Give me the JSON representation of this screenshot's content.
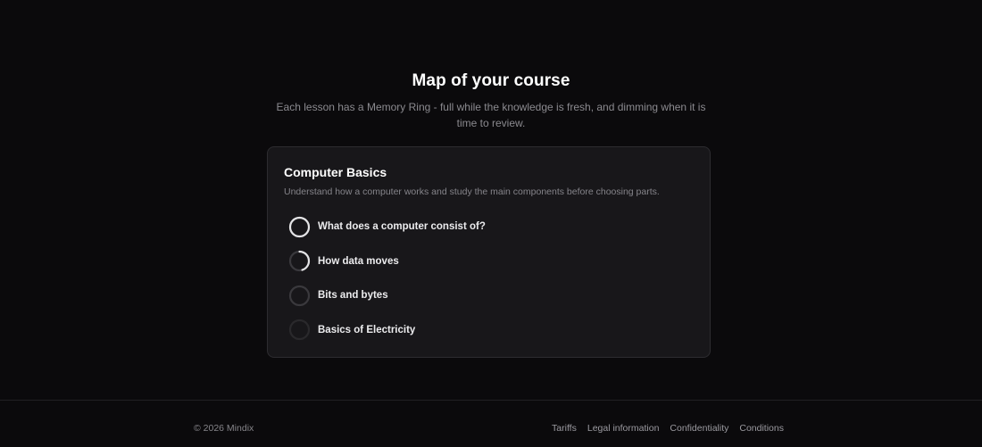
{
  "hero": {
    "title": "Map of your course",
    "subtitle": "Each lesson has a Memory Ring - full while the knowledge is fresh, and dimming when it is time to review."
  },
  "course": {
    "title": "Computer Basics",
    "description": "Understand how a computer works and study the main components before choosing parts.",
    "lessons": [
      {
        "label": "What does a computer consist of?",
        "memory_ring": 1.0,
        "ring_icon": "memory-ring-full-icon"
      },
      {
        "label": "How data moves",
        "memory_ring": 0.45,
        "ring_icon": "memory-ring-partial-icon"
      },
      {
        "label": "Bits and bytes",
        "memory_ring": 0.0,
        "ring_icon": "memory-ring-empty-icon"
      },
      {
        "label": "Basics of Electricity",
        "memory_ring": 0.0,
        "ring_icon": "memory-ring-dim-icon"
      }
    ]
  },
  "colors": {
    "background": "#0b0a0c",
    "card": "#18171a",
    "ring_fill": "#e4e4e6",
    "ring_track": "#3a393d",
    "ring_track_dim": "#2a292c"
  },
  "footer": {
    "copyright": "© 2026 Mindix",
    "links": [
      "Tariffs",
      "Legal information",
      "Confidentiality",
      "Conditions"
    ]
  }
}
